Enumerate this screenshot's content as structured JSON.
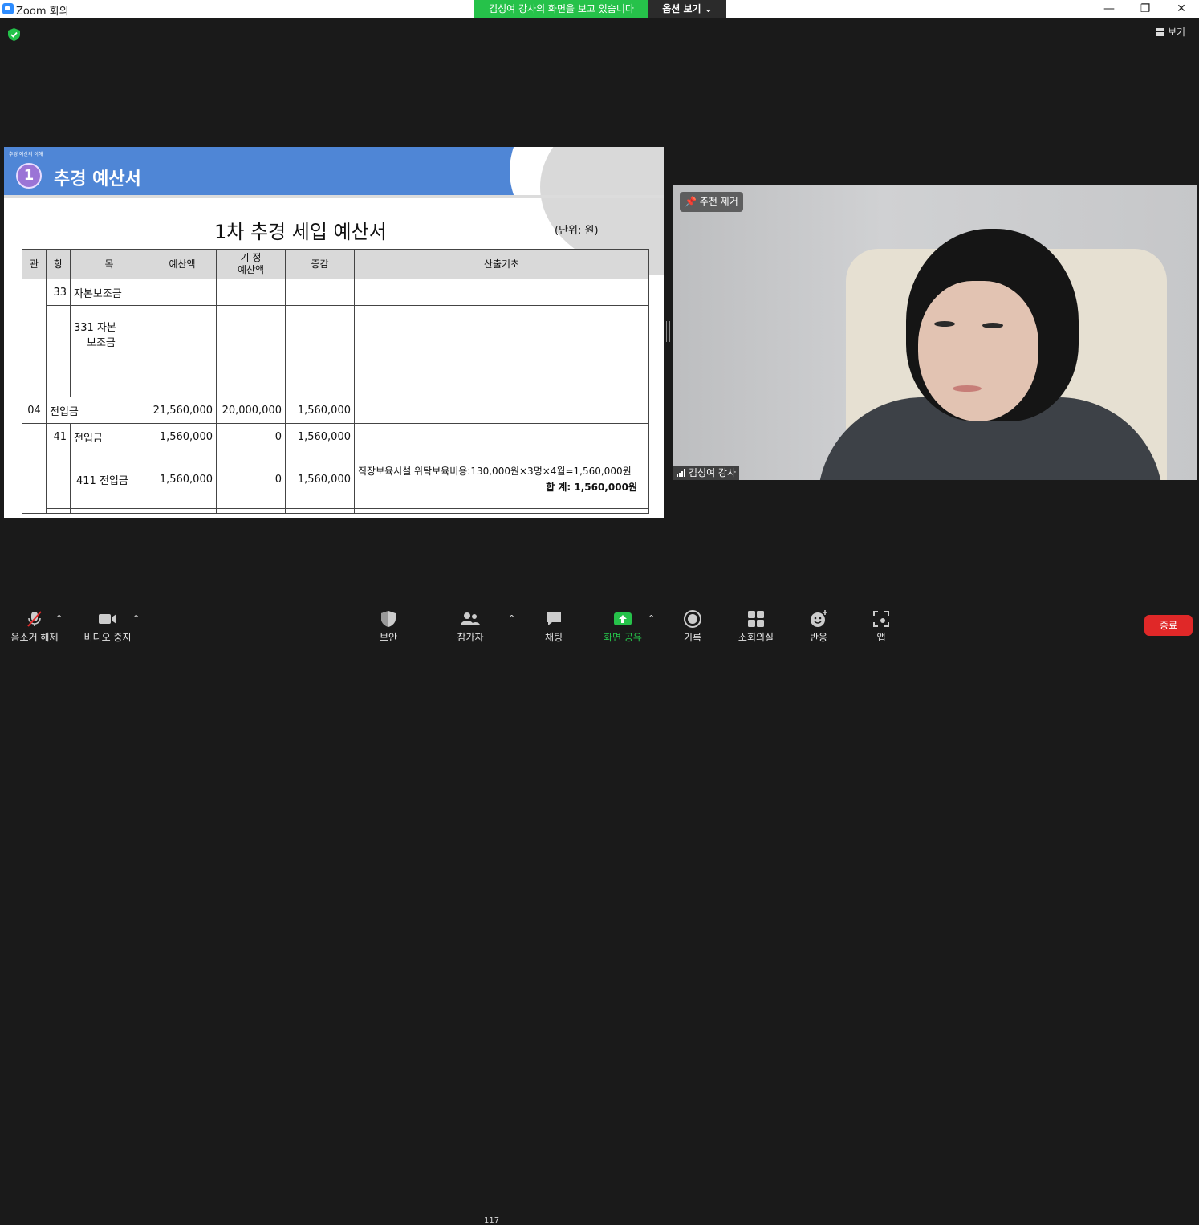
{
  "window": {
    "title": "Zoom 회의",
    "minimize": "—",
    "maximize": "❐",
    "close": "✕"
  },
  "share_banner": {
    "text": "김성여 강사의 화면을 보고 있습니다",
    "options_label": "옵션 보기 ⌄"
  },
  "view_button": "보기",
  "colors": {
    "share_green": "#26c24a",
    "end_red": "#e02828",
    "slide_blue": "#4f86d6"
  },
  "slide": {
    "subtitle": "추경 예산의 이해",
    "number": "1",
    "title": "추경 예산서",
    "doc_title": "1차 추경 세입 예산서",
    "unit": "(단위: 원)",
    "table": {
      "headers": [
        "관",
        "항",
        "목",
        "예산액",
        "기 정",
        "예산액",
        "증감",
        "산출기초"
      ],
      "rows": [
        {
          "gwan": "",
          "hang": "33",
          "mok": "자본보조금",
          "budget": "",
          "existing": "",
          "change": "",
          "basis": ""
        },
        {
          "gwan": "",
          "hang": "",
          "mok_line1": "331 자본",
          "mok_line2": "보조금",
          "budget": "",
          "existing": "",
          "change": "",
          "basis": ""
        },
        {
          "gwan": "04",
          "hang": "전입금",
          "budget": "21,560,000",
          "existing": "20,000,000",
          "change": "1,560,000",
          "basis": ""
        },
        {
          "gwan": "",
          "hang": "41",
          "mok": "전입금",
          "budget": "1,560,000",
          "existing": "0",
          "change": "1,560,000",
          "basis": ""
        },
        {
          "gwan": "",
          "hang": "",
          "mok": "411  전입금",
          "budget": "1,560,000",
          "existing": "0",
          "change": "1,560,000",
          "basis_line1": "직장보육시설 위탁보육비용:130,000원×3명×4월=1,560,000원",
          "basis_line2": "합 계:   1,560,000원"
        }
      ]
    }
  },
  "video": {
    "pin_label": "추천 제거",
    "participant_name": "김성여 강사"
  },
  "toolbar": {
    "mute": "음소거 해제",
    "video": "비디오 중지",
    "security": "보안",
    "participants": "참가자",
    "participant_count": "117",
    "chat": "채팅",
    "share": "화면 공유",
    "record": "기록",
    "breakout": "소회의실",
    "reactions": "반응",
    "apps": "앱",
    "end": "종료"
  }
}
